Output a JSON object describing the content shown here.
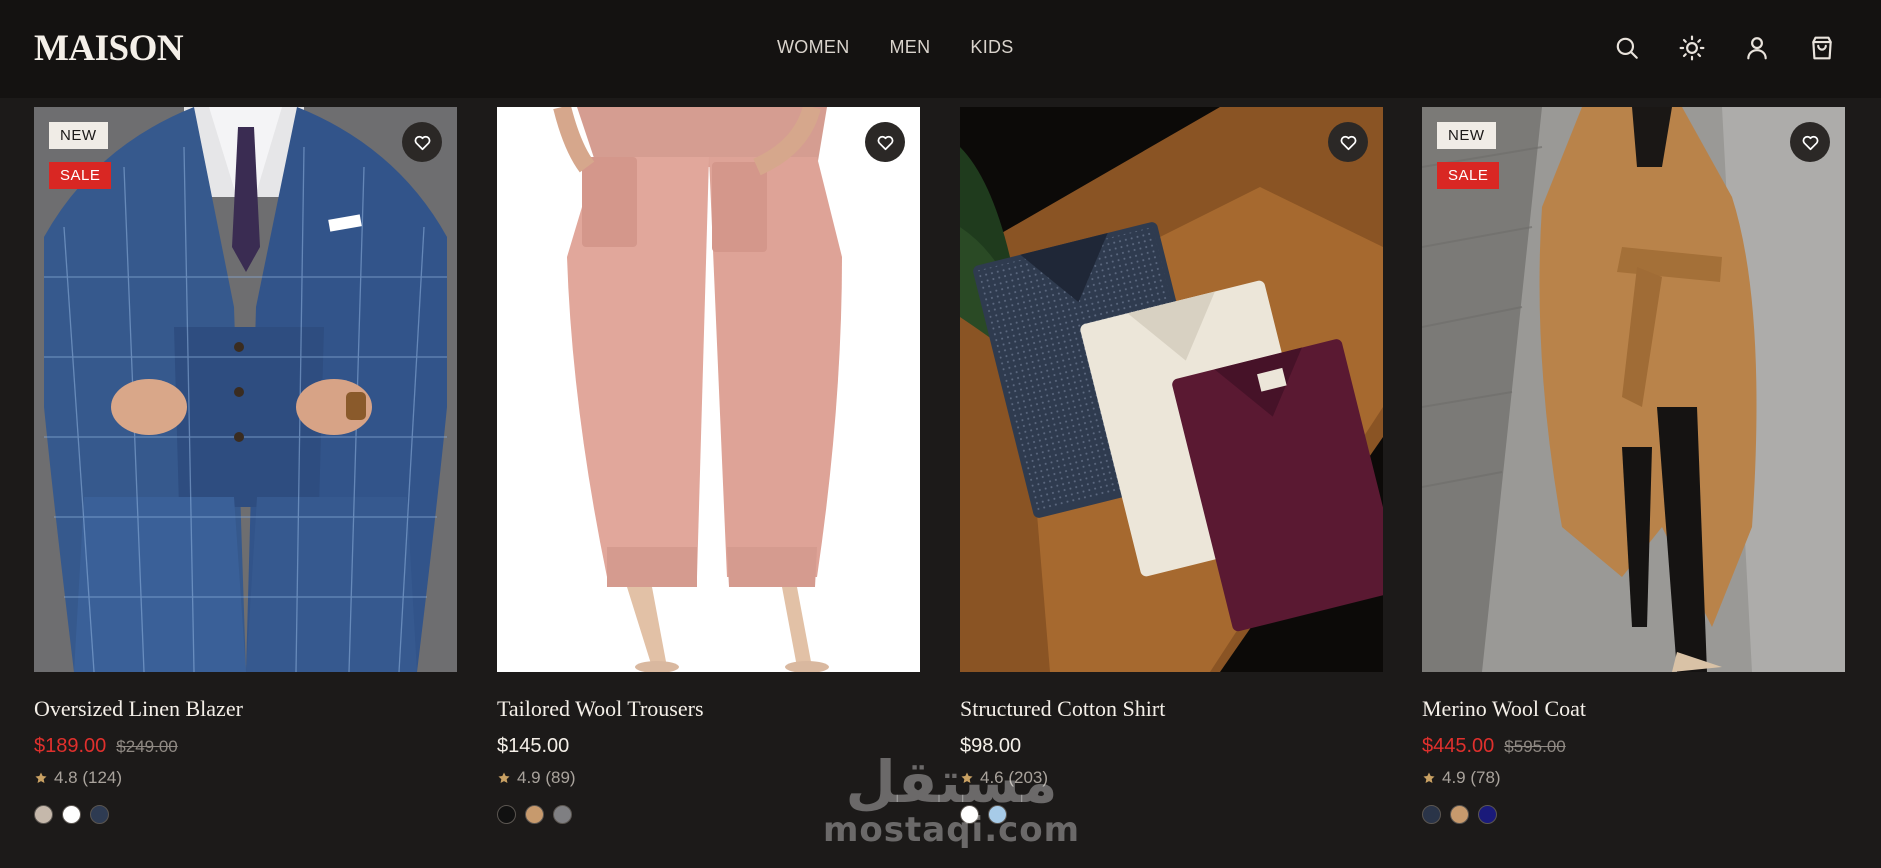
{
  "header": {
    "logo": "MAISON",
    "nav": [
      "WOMEN",
      "MEN",
      "KIDS"
    ],
    "icons": [
      "search-icon",
      "sun-icon",
      "user-icon",
      "bag-icon"
    ]
  },
  "products": [
    {
      "name": "Oversized Linen Blazer",
      "price": "$189.00",
      "old_price": "$249.00",
      "rating": "4.8 (124)",
      "badges": [
        "NEW",
        "SALE"
      ],
      "swatches": [
        "#c5b8ab",
        "#ffffff",
        "#2e3b52"
      ],
      "image": "blue plaid three-piece suit"
    },
    {
      "name": "Tailored Wool Trousers",
      "price": "$145.00",
      "old_price": "",
      "rating": "4.9 (89)",
      "badges": [],
      "swatches": [
        "#111111",
        "#c79a6d",
        "#7f7f82"
      ],
      "image": "pink jogger trousers"
    },
    {
      "name": "Structured Cotton Shirt",
      "price": "$98.00",
      "old_price": "",
      "rating": "4.6 (203)",
      "badges": [],
      "swatches": [
        "#ffffff",
        "#a7cbe8"
      ],
      "image": "folded dress shirts"
    },
    {
      "name": "Merino Wool Coat",
      "price": "$445.00",
      "old_price": "$595.00",
      "rating": "4.9 (78)",
      "badges": [
        "NEW",
        "SALE"
      ],
      "swatches": [
        "#2a3448",
        "#c79a6d",
        "#1a1a7a"
      ],
      "image": "camel wrap coat"
    }
  ],
  "watermark": {
    "arabic": "مستقل",
    "latin": "mostaqi.com"
  },
  "colors": {
    "sale": "#e0302d",
    "background": "#1c1a19",
    "header": "#141211"
  }
}
